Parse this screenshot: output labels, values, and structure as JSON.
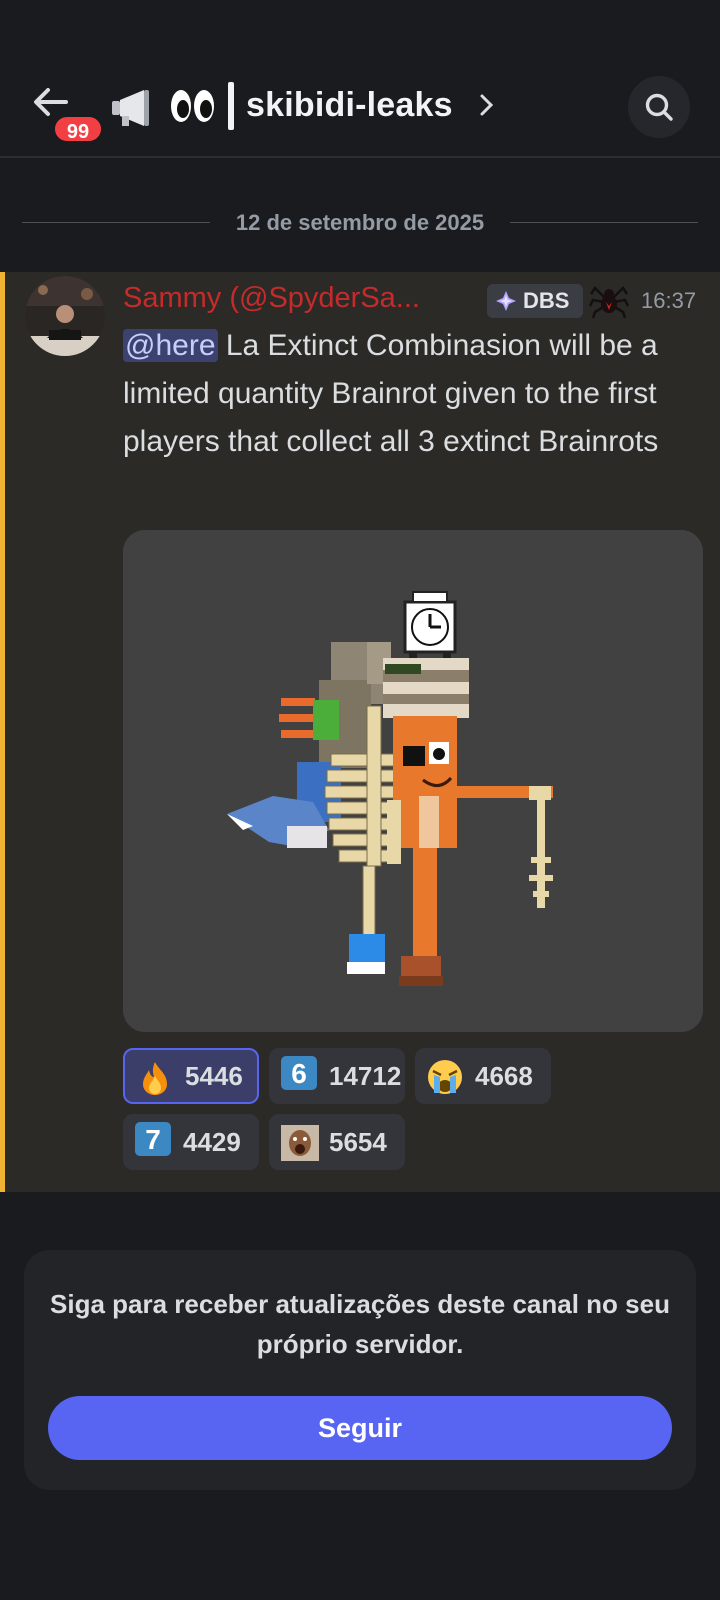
{
  "header": {
    "unread_badge": "99",
    "channel_name": "skibidi-leaks",
    "icons": [
      "back-arrow-icon",
      "megaphone-icon",
      "eyes-icon",
      "chevron-right-icon",
      "search-icon"
    ]
  },
  "date_divider": "12 de setembro de 2025",
  "message": {
    "author": "Sammy (@SpyderSa...",
    "author_color": "#c42b2b",
    "tag": "DBS",
    "timestamp": "16:37",
    "mention": "@here",
    "text": " La Extinct Combinasion will be a limited quantity Brainrot given to the first players that collect all 3 extinct Brainrots",
    "accent_color": "#f0b232"
  },
  "reactions": [
    {
      "emoji": "fire-icon",
      "count": "5446",
      "active": true
    },
    {
      "emoji": "keycap-6",
      "label": "6",
      "count": "14712"
    },
    {
      "emoji": "crying-face-icon",
      "count": "4668"
    },
    {
      "emoji": "keycap-7",
      "label": "7",
      "count": "4429"
    },
    {
      "emoji": "meme-face-icon",
      "count": "5654"
    }
  ],
  "follow_card": {
    "text": "Siga para receber atualizações deste canal no seu próprio servidor.",
    "button_label": "Seguir",
    "button_color": "#5865f2"
  }
}
